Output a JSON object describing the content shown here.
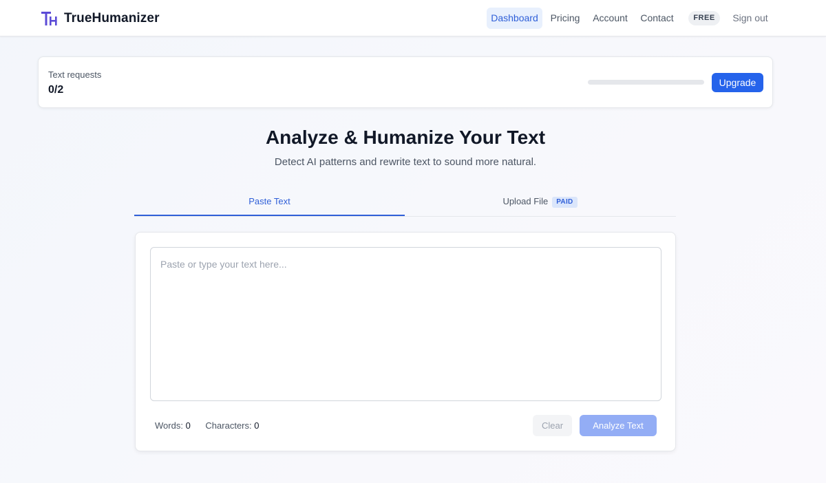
{
  "brand": {
    "name": "TrueHumanizer",
    "logo_icon": "th-monogram-icon",
    "accent": "#5b4bd6"
  },
  "nav": {
    "items": [
      {
        "label": "Dashboard",
        "active": true
      },
      {
        "label": "Pricing"
      },
      {
        "label": "Account"
      },
      {
        "label": "Contact"
      }
    ],
    "plan_badge": "FREE",
    "sign_out": "Sign out"
  },
  "usage": {
    "label": "Text requests",
    "value": "0/2",
    "progress_fraction": 0.0,
    "upgrade_label": "Upgrade"
  },
  "hero": {
    "title": "Analyze & Humanize Your Text",
    "subtitle": "Detect AI patterns and rewrite text to sound more natural."
  },
  "tabs": [
    {
      "label": "Paste Text",
      "active": true
    },
    {
      "label": "Upload File",
      "badge": "PAID"
    }
  ],
  "editor": {
    "placeholder": "Paste or type your text here...",
    "value": "",
    "words_label": "Words:",
    "words_count": "0",
    "characters_label": "Characters:",
    "characters_count": "0",
    "clear_label": "Clear",
    "analyze_label": "Analyze Text"
  },
  "colors": {
    "primary": "#2563eb",
    "active_tab": "#2f5fd8",
    "disabled_primary": "#93adf5"
  }
}
